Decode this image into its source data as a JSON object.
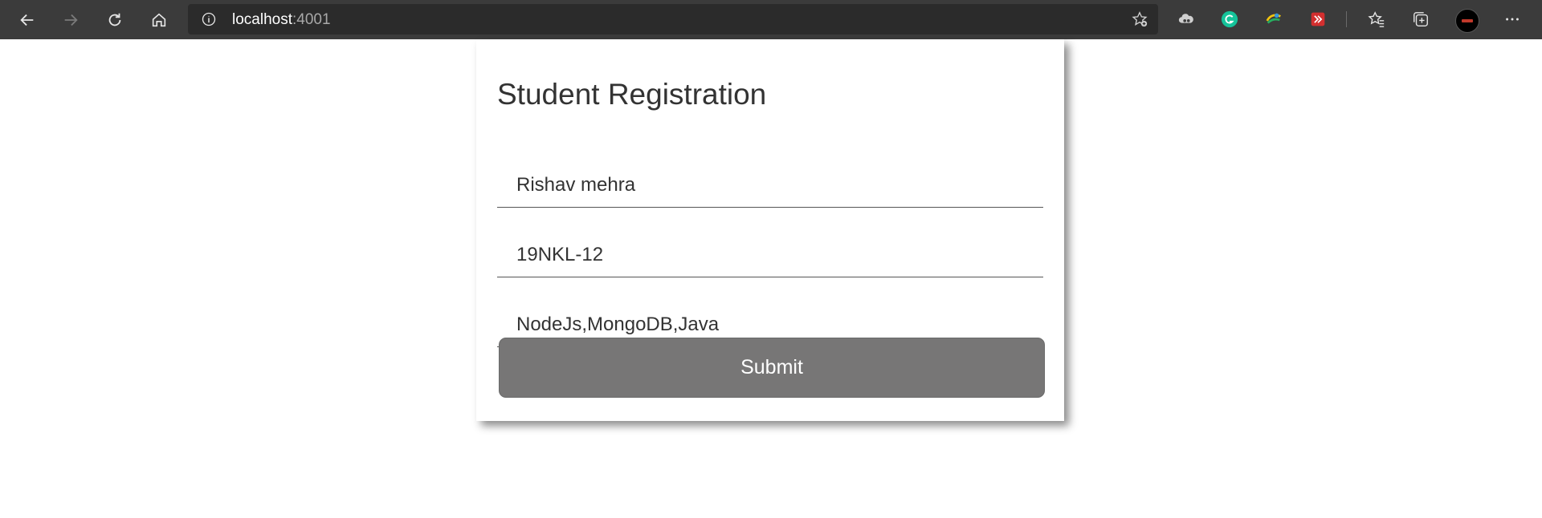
{
  "browser": {
    "url_host": "localhost",
    "url_port": ":4001",
    "icons": [
      "back-icon",
      "forward-icon",
      "refresh-icon",
      "home-icon",
      "info-icon",
      "add-favorite-icon",
      "cloud-extension-icon",
      "grammarly-icon",
      "colorful-extension-icon",
      "red-extension-icon",
      "favorites-icon",
      "collections-icon",
      "profile-avatar",
      "more-options-icon"
    ]
  },
  "form": {
    "title": "Student Registration",
    "name_value": "Rishav mehra",
    "id_value": "19NKL-12",
    "skills_value": "NodeJs,MongoDB,Java",
    "submit_label": "Submit"
  },
  "colors": {
    "chrome_bg": "#3b3b3b",
    "address_bg": "#2b2b2b",
    "button_bg": "#777676",
    "grammarly": "#15c39a"
  }
}
